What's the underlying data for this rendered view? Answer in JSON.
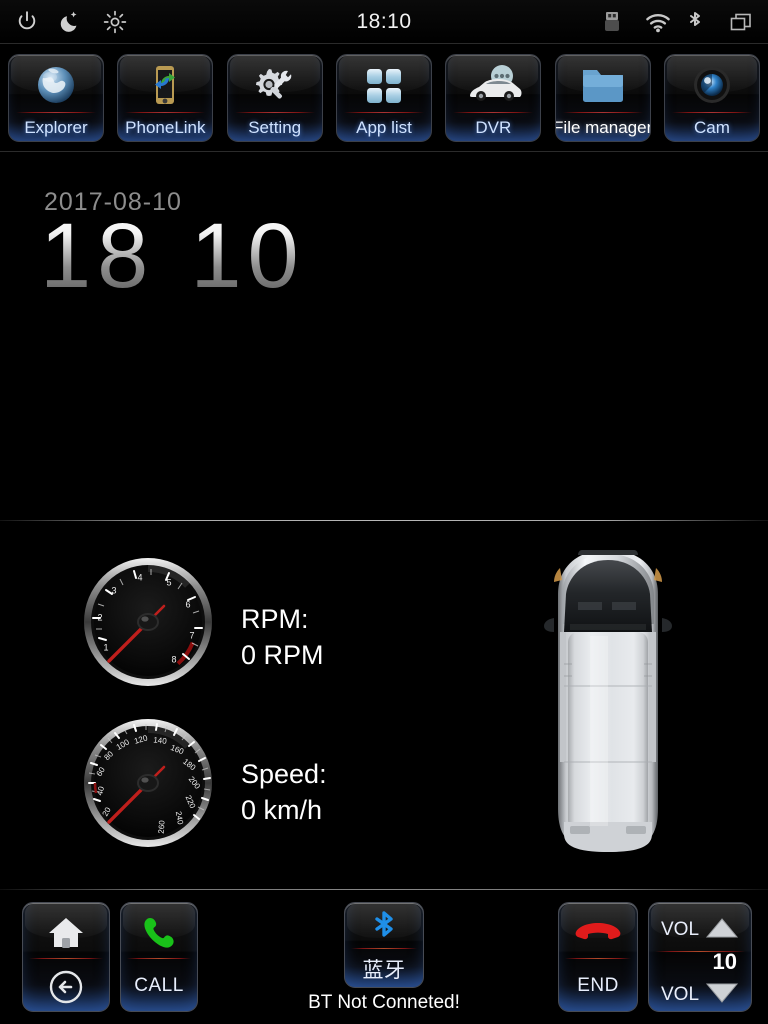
{
  "status_bar": {
    "time": "18:10",
    "left_icons": [
      {
        "name": "power-icon",
        "label": "Power"
      },
      {
        "name": "night-mode-icon",
        "label": "Night mode"
      },
      {
        "name": "brightness-icon",
        "label": "Brightness"
      }
    ],
    "right_icons": [
      {
        "name": "usb-icon",
        "label": "USB"
      },
      {
        "name": "wifi-icon",
        "label": "Wi-Fi"
      },
      {
        "name": "bluetooth-icon",
        "label": "Bluetooth"
      },
      {
        "name": "recent-apps-icon",
        "label": "Recent apps"
      }
    ]
  },
  "dock": {
    "apps": [
      {
        "label": "Explorer",
        "icon": "globe-icon",
        "label_color": "blue"
      },
      {
        "label": "PhoneLink",
        "icon": "phonelink-icon",
        "label_color": "blue"
      },
      {
        "label": "Setting",
        "icon": "gear-wrench-icon",
        "label_color": "blue"
      },
      {
        "label": "App list",
        "icon": "grid-apps-icon",
        "label_color": "blue"
      },
      {
        "label": "DVR",
        "icon": "car-camera-icon",
        "label_color": "blue"
      },
      {
        "label": "File manager",
        "icon": "folder-icon",
        "label_color": "white"
      },
      {
        "label": "Cam",
        "icon": "camera-lens-icon",
        "label_color": "blue"
      }
    ]
  },
  "clock_panel": {
    "date": "2017-08-10",
    "hours": "18",
    "minutes": "10"
  },
  "vehicle_panel": {
    "rpm": {
      "title": "RPM:",
      "value": "0 RPM",
      "gauge_name": "tachometer-gauge",
      "ticks": [
        "1",
        "2",
        "3",
        "4",
        "5",
        "6",
        "7",
        "8"
      ],
      "needle_value": 0,
      "max": 8,
      "redline_start": 7
    },
    "speed": {
      "title": "Speed:",
      "value": "0 km/h",
      "gauge_name": "speedometer-gauge",
      "ticks": [
        "20",
        "40",
        "60",
        "80",
        "100",
        "120",
        "140",
        "160",
        "180",
        "200",
        "220",
        "240",
        "260"
      ],
      "needle_value": 0,
      "max": 260
    },
    "car_image": "top-view-van-illustration"
  },
  "bottom_bar": {
    "home": {
      "top_icon": "home-icon",
      "bottom_icon": "back-arrow-icon"
    },
    "call": {
      "top_icon": "phone-call-icon",
      "label": "CALL"
    },
    "bluetooth": {
      "top_icon": "bluetooth-icon",
      "label": "蓝牙",
      "status": "BT Not Conneted!"
    },
    "end": {
      "top_icon": "phone-end-icon",
      "label": "END"
    },
    "volume": {
      "up_label": "VOL",
      "down_label": "VOL",
      "level": "10",
      "up_icon": "triangle-up-icon",
      "down_icon": "triangle-down-icon"
    }
  },
  "colors": {
    "accent_blue": "#5a9bff",
    "label_blue": "#cfe2ff",
    "redline": "#a33333",
    "needle_red": "#c0201c",
    "bt_blue": "#1f8fe8",
    "call_green": "#19c119",
    "end_red": "#e01b1b",
    "background": "#000000"
  }
}
